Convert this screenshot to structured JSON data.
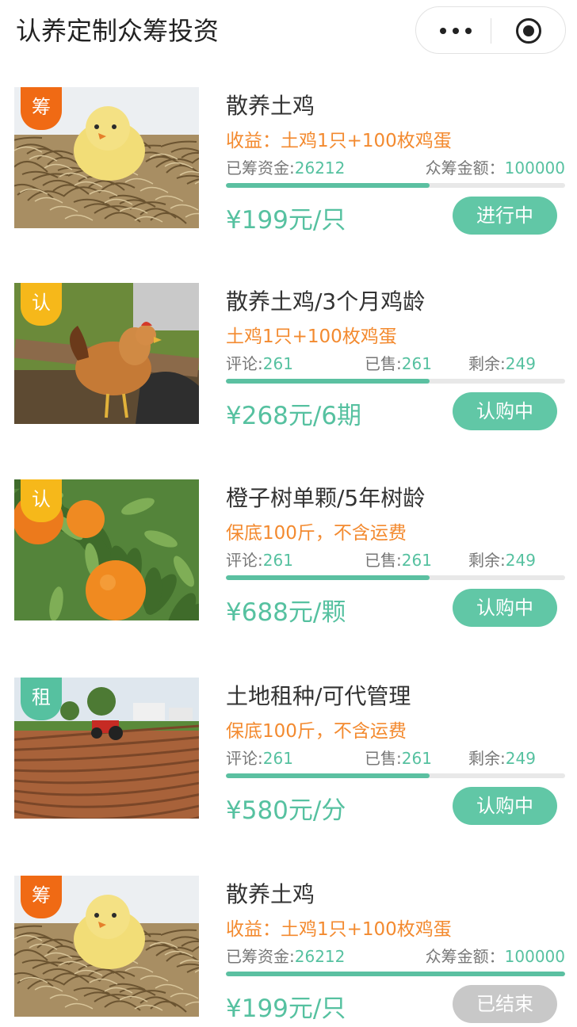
{
  "navbar": {
    "title": "认养定制众筹投资",
    "more_icon": "more-dots-icon",
    "close_icon": "target-close-icon"
  },
  "colors": {
    "accent": "#56c1a0",
    "orange": "#f38a2f",
    "tag_orange": "#f06a14",
    "tag_yellow": "#f6b81a",
    "ended_gray": "#c8c8c8"
  },
  "items": [
    {
      "tag": "筹",
      "tag_color": "orange",
      "image": "chick-in-nest",
      "title": "散养土鸡",
      "profit": "收益：土鸡1只+100枚鸡蛋",
      "stats": [
        {
          "label": "已筹资金:",
          "value": "26212"
        },
        {
          "label": "众筹金额：",
          "value": "100000"
        }
      ],
      "progress": 0.6,
      "price": "¥199元/只",
      "status": "进行中",
      "status_state": "active"
    },
    {
      "tag": "认",
      "tag_color": "yellow",
      "image": "hen-on-farm",
      "title": "散养土鸡/3个月鸡龄",
      "profit": "土鸡1只+100枚鸡蛋",
      "stats": [
        {
          "label": "评论:",
          "value": "261"
        },
        {
          "label": "已售:",
          "value": "261"
        },
        {
          "label": "剩余:",
          "value": "249"
        }
      ],
      "progress": 0.6,
      "price": "¥268元/6期",
      "status": "认购中",
      "status_state": "active"
    },
    {
      "tag": "认",
      "tag_color": "yellow",
      "image": "orange-tree",
      "title": "橙子树单颗/5年树龄",
      "profit": "保底100斤，不含运费",
      "stats": [
        {
          "label": "评论:",
          "value": "261"
        },
        {
          "label": "已售:",
          "value": "261"
        },
        {
          "label": "剩余:",
          "value": "249"
        }
      ],
      "progress": 0.6,
      "price": "¥688元/颗",
      "status": "认购中",
      "status_state": "active"
    },
    {
      "tag": "租",
      "tag_color": "teal",
      "image": "farmland-tractor",
      "title": "土地租种/可代管理",
      "profit": "保底100斤，不含运费",
      "stats": [
        {
          "label": "评论:",
          "value": "261"
        },
        {
          "label": "已售:",
          "value": "261"
        },
        {
          "label": "剩余:",
          "value": "249"
        }
      ],
      "progress": 0.6,
      "price": "¥580元/分",
      "status": "认购中",
      "status_state": "active"
    },
    {
      "tag": "筹",
      "tag_color": "orange",
      "image": "chick-in-nest",
      "title": "散养土鸡",
      "profit": "收益：土鸡1只+100枚鸡蛋",
      "stats": [
        {
          "label": "已筹资金:",
          "value": "26212"
        },
        {
          "label": "众筹金额：",
          "value": "100000"
        }
      ],
      "progress": 1.0,
      "price": "¥199元/只",
      "status": "已结束",
      "status_state": "ended"
    }
  ]
}
